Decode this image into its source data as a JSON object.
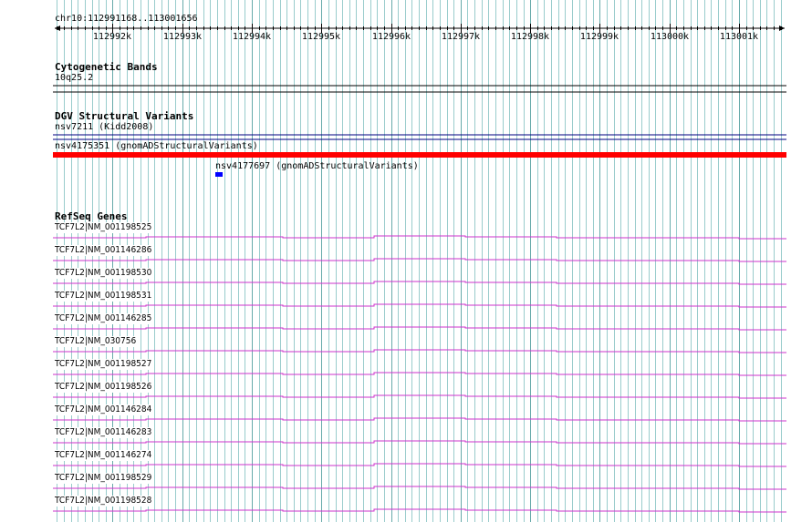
{
  "ruler": {
    "region_label": "chr10:112991168..113001656",
    "ticks": [
      "112992k",
      "112993k",
      "112994k",
      "112995k",
      "112996k",
      "112997k",
      "112998k",
      "112999k",
      "113000k",
      "113001k"
    ]
  },
  "cytoband": {
    "title": "Cytogenetic Bands",
    "band": "10q25.2"
  },
  "dgv": {
    "title": "DGV Structural Variants",
    "features": [
      {
        "label": "nsv7211 (Kidd2008)",
        "color": "#000080"
      },
      {
        "label": "nsv4175351 (gnomADStructuralVariants)",
        "color": "#ff0000"
      },
      {
        "label": "nsv4177697 (gnomADStructuralVariants)",
        "color": "#0000ff"
      }
    ]
  },
  "refseq": {
    "title": "RefSeq Genes",
    "color": "#cc33cc",
    "genes": [
      "TCF7L2|NM_001198525",
      "TCF7L2|NM_001146286",
      "TCF7L2|NM_001198530",
      "TCF7L2|NM_001198531",
      "TCF7L2|NM_001146285",
      "TCF7L2|NM_030756",
      "TCF7L2|NM_001198527",
      "TCF7L2|NM_001198526",
      "TCF7L2|NM_001146284",
      "TCF7L2|NM_001146283",
      "TCF7L2|NM_001146274",
      "TCF7L2|NM_001198529",
      "TCF7L2|NM_001198528"
    ]
  },
  "colors": {
    "grid": "#99cccc",
    "grid_major": "#66aaaa",
    "rule": "#000000"
  }
}
